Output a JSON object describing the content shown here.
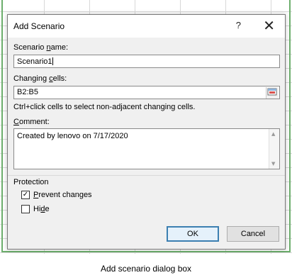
{
  "dialog": {
    "title": "Add Scenario",
    "help_icon": "?",
    "close_icon": "✕"
  },
  "scenario_name": {
    "label": "Scenario name:",
    "value": "Scenario1"
  },
  "changing_cells": {
    "label": "Changing cells:",
    "value": "B2:B5",
    "hint": "Ctrl+click cells to select non-adjacent changing cells."
  },
  "comment": {
    "label": "Comment:",
    "value": "Created by lenovo on 7/17/2020"
  },
  "protection": {
    "label": "Protection",
    "prevent_changes_label": "Prevent changes",
    "prevent_changes_checked": true,
    "hide_label": "Hide",
    "hide_checked": false
  },
  "buttons": {
    "ok": "OK",
    "cancel": "Cancel"
  },
  "caption": "Add scenario dialog box",
  "colors": {
    "dialog_bg": "#f0f0f0",
    "sheet_border": "#6cae6c",
    "default_button_border": "#3c7fb1"
  }
}
